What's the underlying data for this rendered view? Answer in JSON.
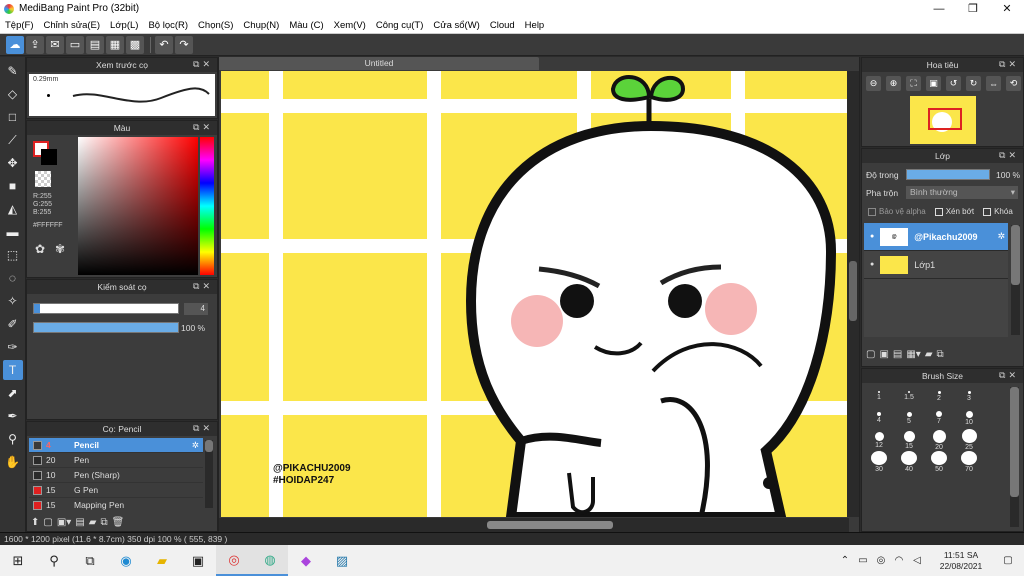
{
  "window": {
    "title": "MediBang Paint Pro (32bit)",
    "min": "—",
    "max": "❐",
    "close": "✕"
  },
  "menu": [
    "Tệp(F)",
    "Chỉnh sửa(E)",
    "Lớp(L)",
    "Bộ lọc(R)",
    "Chọn(S)",
    "Chụp(N)",
    "Màu (C)",
    "Xem(V)",
    "Công cụ(T)",
    "Cửa sổ(W)",
    "Cloud",
    "Help"
  ],
  "brush_preview": {
    "title": "Xem trước cọ",
    "size_label": "0.29mm"
  },
  "color_panel": {
    "title": "Màu",
    "r": "R:255",
    "g": "G:255",
    "b": "B:255",
    "hex": "#FFFFFF"
  },
  "brush_control": {
    "title": "Kiểm soát cọ",
    "size_value": "4",
    "opacity_value": "100 %",
    "size_fraction": 0.04,
    "opacity_fraction": 1.0
  },
  "brushes": {
    "title": "Cọ: Pencil",
    "items": [
      {
        "size": "4",
        "name": "Pencil",
        "color": "#ffffff",
        "selected": true
      },
      {
        "size": "20",
        "name": "Pen",
        "color": "#2a2a2a",
        "selected": false
      },
      {
        "size": "10",
        "name": "Pen (Sharp)",
        "color": "#2a2a2a",
        "selected": false
      },
      {
        "size": "15",
        "name": "G Pen",
        "color": "#e02020",
        "selected": false
      },
      {
        "size": "15",
        "name": "Mapping Pen",
        "color": "#e02020",
        "selected": false
      }
    ]
  },
  "document": {
    "tab_title": "Untitled",
    "watermark_line1": "@PIKACHU2009",
    "watermark_line2": "#HOIDAP247"
  },
  "navigator": {
    "title": "Hoa tiêu"
  },
  "layers": {
    "title": "Lớp",
    "opacity_label": "Độ trong",
    "opacity_value": "100 %",
    "opacity_fraction": 1.0,
    "blend_label": "Pha trộn",
    "blend_value": "Bình thường",
    "protect_alpha": "Bảo vệ alpha",
    "clipping": "Xén bớt",
    "lock": "Khóa",
    "items": [
      {
        "name": "@Pikachu2009",
        "selected": true
      },
      {
        "name": "Lớp1",
        "selected": false
      }
    ]
  },
  "brush_size": {
    "title": "Brush Size",
    "values": [
      "1",
      "1.5",
      "2",
      "3",
      "4",
      "5",
      "7",
      "10",
      "12",
      "15",
      "20",
      "25",
      "30",
      "40",
      "50",
      "70"
    ]
  },
  "status": {
    "text": "1600 * 1200 pixel  (11.6 * 8.7cm)  350 dpi  100 %  ( 555, 839 )"
  },
  "taskbar": {
    "time": "11:51 SA",
    "date": "22/08/2021"
  }
}
